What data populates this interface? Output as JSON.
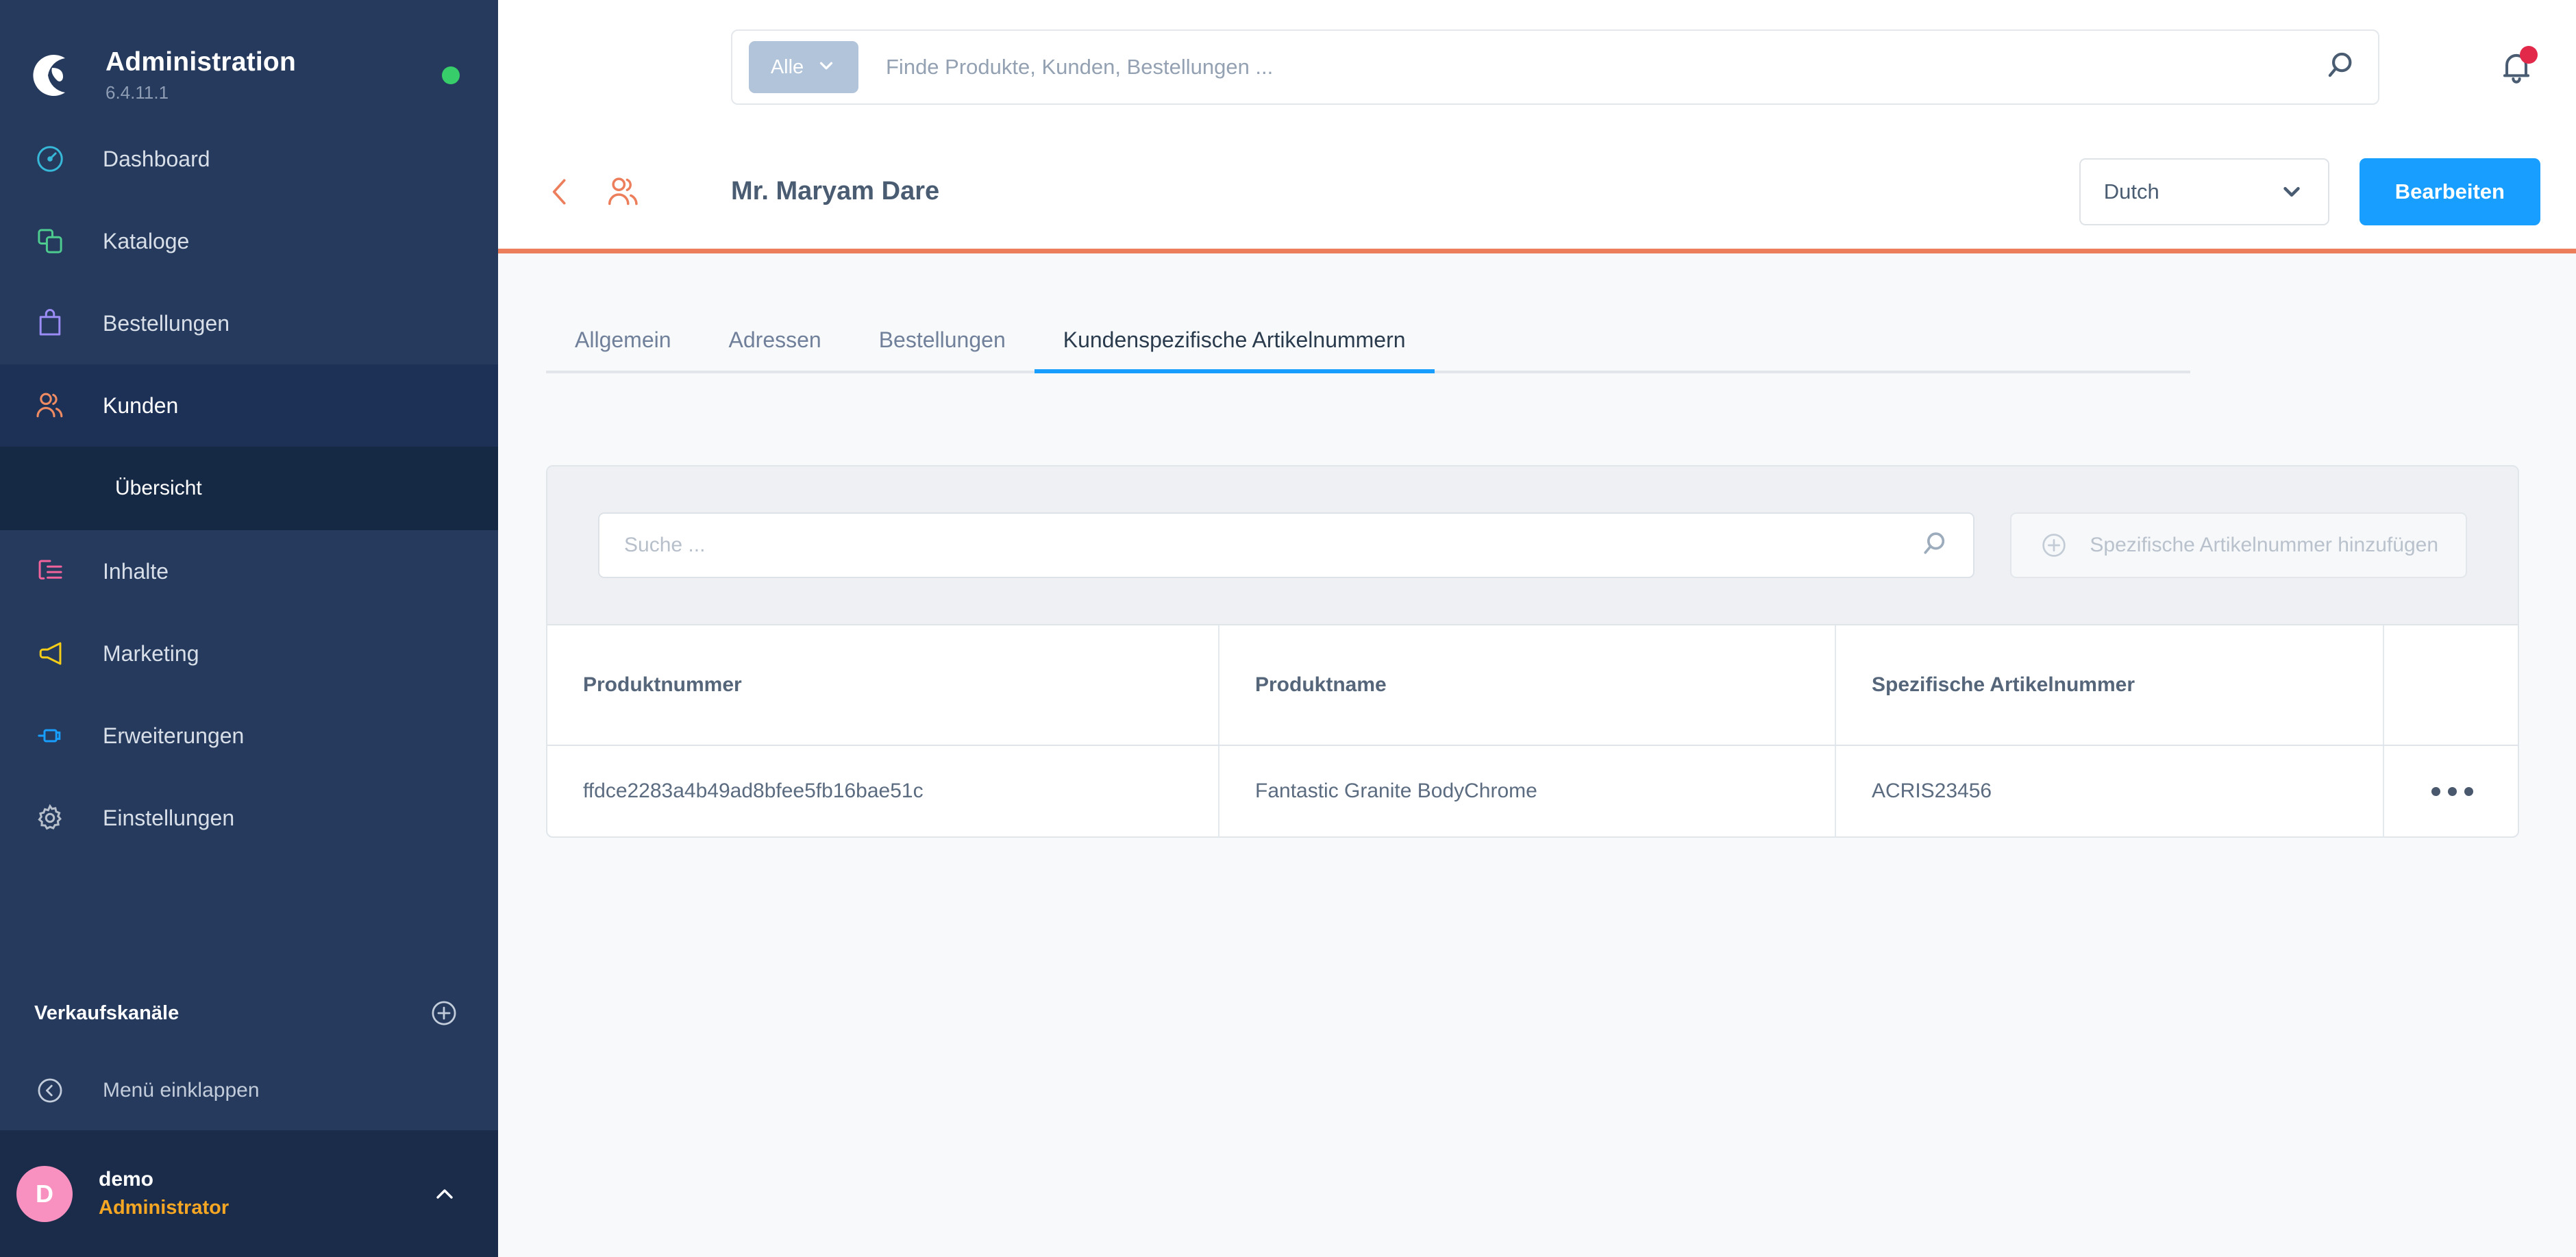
{
  "sidebar": {
    "brand": {
      "title": "Administration",
      "version": "6.4.11.1",
      "status_icon": "status-dot-online",
      "status_color": "#37cd6a"
    },
    "items": [
      {
        "label": "Dashboard",
        "icon": "gauge-icon",
        "color": "#37b8d8",
        "active": false
      },
      {
        "label": "Kataloge",
        "icon": "catalog-icon",
        "color": "#4ecb8e",
        "active": false
      },
      {
        "label": "Bestellungen",
        "icon": "bag-icon",
        "color": "#9b8cf5",
        "active": false
      },
      {
        "label": "Kunden",
        "icon": "customers-icon",
        "color": "#ef8b63",
        "active": true
      },
      {
        "label": "Inhalte",
        "icon": "content-icon",
        "color": "#f2629b",
        "active": false
      },
      {
        "label": "Marketing",
        "icon": "megaphone-icon",
        "color": "#f5cd19",
        "active": false
      },
      {
        "label": "Erweiterungen",
        "icon": "plug-icon",
        "color": "#189eff",
        "active": false
      },
      {
        "label": "Einstellungen",
        "icon": "gear-icon",
        "color": "#b6bfca",
        "active": false
      }
    ],
    "sub_item": {
      "label": "Übersicht"
    },
    "channels": {
      "title": "Verkaufskanäle",
      "add_icon": "plus-circle-icon"
    },
    "collapse": {
      "label": "Menü einklappen",
      "icon": "chevron-left-circle-icon"
    },
    "user": {
      "initial": "D",
      "name": "demo",
      "role": "Administrator",
      "caret_icon": "chevron-up-icon",
      "avatar_color": "#f890c0",
      "role_color": "#f5a623"
    }
  },
  "topbar": {
    "search": {
      "scope_label": "Alle",
      "scope_caret_icon": "chevron-down-icon",
      "value": "",
      "placeholder": "Finde Produkte, Kunden, Bestellungen ...",
      "icon": "search-icon"
    },
    "notifications": {
      "icon": "bell-icon",
      "has_badge": true,
      "badge_color": "#e3294a"
    }
  },
  "smart_bar": {
    "back_icon": "chevron-left-icon",
    "entity_icon": "customers-icon",
    "title": "Mr. Maryam Dare",
    "language": {
      "value": "Dutch",
      "caret_icon": "chevron-down-icon"
    },
    "edit_button": {
      "label": "Bearbeiten",
      "color": "#189eff"
    },
    "divider_color": "#ec7e5c"
  },
  "tabs": [
    {
      "label": "Allgemein",
      "active": false
    },
    {
      "label": "Adressen",
      "active": false
    },
    {
      "label": "Bestellungen",
      "active": false
    },
    {
      "label": "Kundenspezifische Artikelnummern",
      "active": true
    }
  ],
  "card": {
    "toolbar": {
      "search": {
        "value": "",
        "placeholder": "Suche ...",
        "icon": "search-icon"
      },
      "add_button": {
        "label": "Spezifische Artikelnummer hinzufügen",
        "icon": "plus-circle-icon",
        "disabled": true
      }
    },
    "table": {
      "columns": [
        "Produktnummer",
        "Produktname",
        "Spezifische Artikelnummer",
        ""
      ],
      "rows": [
        {
          "produktnummer": "ffdce2283a4b49ad8bfee5fb16bae51c",
          "produktname": "Fantastic Granite BodyChrome",
          "spezifische_artikelnummer": "ACRIS23456",
          "actions_icon": "context-menu-icon"
        }
      ]
    }
  }
}
